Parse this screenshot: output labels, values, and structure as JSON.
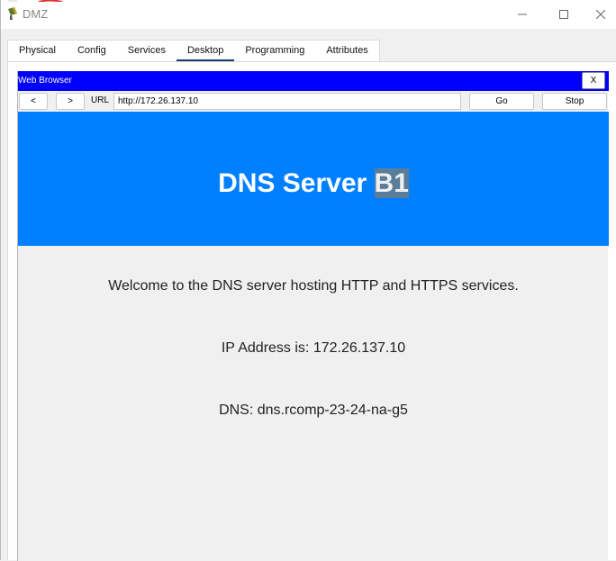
{
  "window": {
    "title": "DMZ"
  },
  "tabs": [
    {
      "label": "Physical"
    },
    {
      "label": "Config"
    },
    {
      "label": "Services"
    },
    {
      "label": "Desktop"
    },
    {
      "label": "Programming"
    },
    {
      "label": "Attributes"
    }
  ],
  "active_tab": "Desktop",
  "browser": {
    "title": "Web Browser",
    "close_label": "X",
    "back_label": "<",
    "forward_label": ">",
    "url_label": "URL",
    "url_value": "http://172.26.137.10",
    "go_label": "Go",
    "stop_label": "Stop"
  },
  "page": {
    "heading_main": "DNS Server ",
    "heading_selected": "B1",
    "lines": [
      "Welcome to the DNS server hosting HTTP and HTTPS services.",
      "IP Address is: 172.26.137.10",
      "DNS: dns.rcomp-23-24-na-g5"
    ]
  },
  "colors": {
    "browser_header": "#0000ff",
    "page_banner": "#0080ff",
    "active_tab_underline": "#1a3d6b",
    "selection_highlight": "#5a7d99"
  },
  "icons": {
    "app": "packet-tracer-icon",
    "minimize": "minimize-icon",
    "maximize": "maximize-icon",
    "close": "close-icon"
  }
}
